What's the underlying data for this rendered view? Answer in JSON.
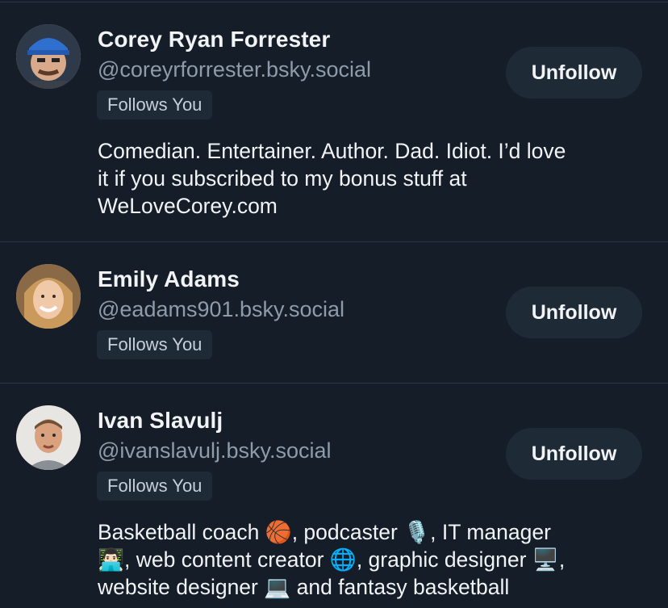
{
  "profiles": [
    {
      "name": "Corey Ryan Forrester",
      "handle": "@coreyrforrester.bsky.social",
      "badge": "Follows You",
      "action": "Unfollow",
      "bio": [
        "Comedian. Entertainer. Author. Dad. Idiot. I’d love",
        "it if you subscribed to my bonus stuff at",
        "WeLoveCorey.com"
      ]
    },
    {
      "name": "Emily Adams",
      "handle": "@eadams901.bsky.social",
      "badge": "Follows You",
      "action": "Unfollow"
    },
    {
      "name": "Ivan Slavulj",
      "handle": "@ivanslavulj.bsky.social",
      "badge": "Follows You",
      "action": "Unfollow",
      "bio": [
        "Basketball coach 🏀, podcaster 🎙️, IT manager",
        "👨🏻‍💻, web content creator 🌐, graphic designer 🖥️,",
        "website designer 💻 and fantasy basketball"
      ]
    }
  ]
}
